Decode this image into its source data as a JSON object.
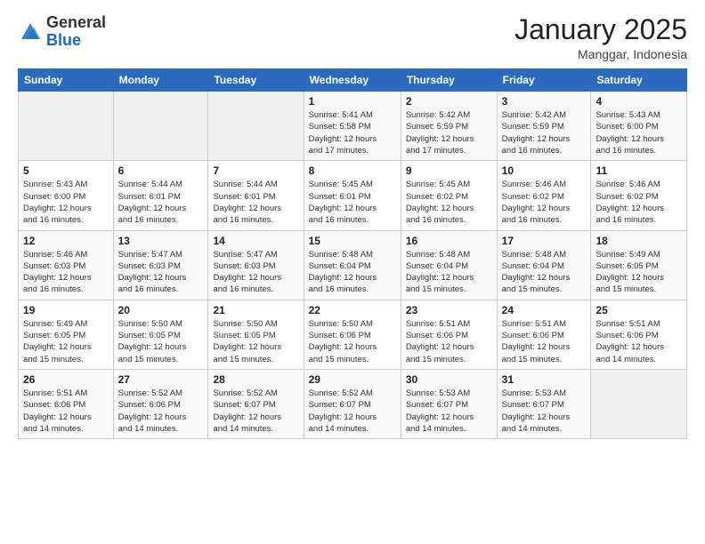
{
  "header": {
    "logo_general": "General",
    "logo_blue": "Blue",
    "month_title": "January 2025",
    "location": "Manggar, Indonesia"
  },
  "days_of_week": [
    "Sunday",
    "Monday",
    "Tuesday",
    "Wednesday",
    "Thursday",
    "Friday",
    "Saturday"
  ],
  "weeks": [
    [
      {
        "day": "",
        "info": ""
      },
      {
        "day": "",
        "info": ""
      },
      {
        "day": "",
        "info": ""
      },
      {
        "day": "1",
        "info": "Sunrise: 5:41 AM\nSunset: 5:58 PM\nDaylight: 12 hours\nand 17 minutes."
      },
      {
        "day": "2",
        "info": "Sunrise: 5:42 AM\nSunset: 5:59 PM\nDaylight: 12 hours\nand 17 minutes."
      },
      {
        "day": "3",
        "info": "Sunrise: 5:42 AM\nSunset: 5:59 PM\nDaylight: 12 hours\nand 16 minutes."
      },
      {
        "day": "4",
        "info": "Sunrise: 5:43 AM\nSunset: 6:00 PM\nDaylight: 12 hours\nand 16 minutes."
      }
    ],
    [
      {
        "day": "5",
        "info": "Sunrise: 5:43 AM\nSunset: 6:00 PM\nDaylight: 12 hours\nand 16 minutes."
      },
      {
        "day": "6",
        "info": "Sunrise: 5:44 AM\nSunset: 6:01 PM\nDaylight: 12 hours\nand 16 minutes."
      },
      {
        "day": "7",
        "info": "Sunrise: 5:44 AM\nSunset: 6:01 PM\nDaylight: 12 hours\nand 16 minutes."
      },
      {
        "day": "8",
        "info": "Sunrise: 5:45 AM\nSunset: 6:01 PM\nDaylight: 12 hours\nand 16 minutes."
      },
      {
        "day": "9",
        "info": "Sunrise: 5:45 AM\nSunset: 6:02 PM\nDaylight: 12 hours\nand 16 minutes."
      },
      {
        "day": "10",
        "info": "Sunrise: 5:46 AM\nSunset: 6:02 PM\nDaylight: 12 hours\nand 16 minutes."
      },
      {
        "day": "11",
        "info": "Sunrise: 5:46 AM\nSunset: 6:02 PM\nDaylight: 12 hours\nand 16 minutes."
      }
    ],
    [
      {
        "day": "12",
        "info": "Sunrise: 5:46 AM\nSunset: 6:03 PM\nDaylight: 12 hours\nand 16 minutes."
      },
      {
        "day": "13",
        "info": "Sunrise: 5:47 AM\nSunset: 6:03 PM\nDaylight: 12 hours\nand 16 minutes."
      },
      {
        "day": "14",
        "info": "Sunrise: 5:47 AM\nSunset: 6:03 PM\nDaylight: 12 hours\nand 16 minutes."
      },
      {
        "day": "15",
        "info": "Sunrise: 5:48 AM\nSunset: 6:04 PM\nDaylight: 12 hours\nand 16 minutes."
      },
      {
        "day": "16",
        "info": "Sunrise: 5:48 AM\nSunset: 6:04 PM\nDaylight: 12 hours\nand 15 minutes."
      },
      {
        "day": "17",
        "info": "Sunrise: 5:48 AM\nSunset: 6:04 PM\nDaylight: 12 hours\nand 15 minutes."
      },
      {
        "day": "18",
        "info": "Sunrise: 5:49 AM\nSunset: 6:05 PM\nDaylight: 12 hours\nand 15 minutes."
      }
    ],
    [
      {
        "day": "19",
        "info": "Sunrise: 5:49 AM\nSunset: 6:05 PM\nDaylight: 12 hours\nand 15 minutes."
      },
      {
        "day": "20",
        "info": "Sunrise: 5:50 AM\nSunset: 6:05 PM\nDaylight: 12 hours\nand 15 minutes."
      },
      {
        "day": "21",
        "info": "Sunrise: 5:50 AM\nSunset: 6:05 PM\nDaylight: 12 hours\nand 15 minutes."
      },
      {
        "day": "22",
        "info": "Sunrise: 5:50 AM\nSunset: 6:06 PM\nDaylight: 12 hours\nand 15 minutes."
      },
      {
        "day": "23",
        "info": "Sunrise: 5:51 AM\nSunset: 6:06 PM\nDaylight: 12 hours\nand 15 minutes."
      },
      {
        "day": "24",
        "info": "Sunrise: 5:51 AM\nSunset: 6:06 PM\nDaylight: 12 hours\nand 15 minutes."
      },
      {
        "day": "25",
        "info": "Sunrise: 5:51 AM\nSunset: 6:06 PM\nDaylight: 12 hours\nand 14 minutes."
      }
    ],
    [
      {
        "day": "26",
        "info": "Sunrise: 5:51 AM\nSunset: 6:06 PM\nDaylight: 12 hours\nand 14 minutes."
      },
      {
        "day": "27",
        "info": "Sunrise: 5:52 AM\nSunset: 6:06 PM\nDaylight: 12 hours\nand 14 minutes."
      },
      {
        "day": "28",
        "info": "Sunrise: 5:52 AM\nSunset: 6:07 PM\nDaylight: 12 hours\nand 14 minutes."
      },
      {
        "day": "29",
        "info": "Sunrise: 5:52 AM\nSunset: 6:07 PM\nDaylight: 12 hours\nand 14 minutes."
      },
      {
        "day": "30",
        "info": "Sunrise: 5:53 AM\nSunset: 6:07 PM\nDaylight: 12 hours\nand 14 minutes."
      },
      {
        "day": "31",
        "info": "Sunrise: 5:53 AM\nSunset: 6:07 PM\nDaylight: 12 hours\nand 14 minutes."
      },
      {
        "day": "",
        "info": ""
      }
    ]
  ]
}
